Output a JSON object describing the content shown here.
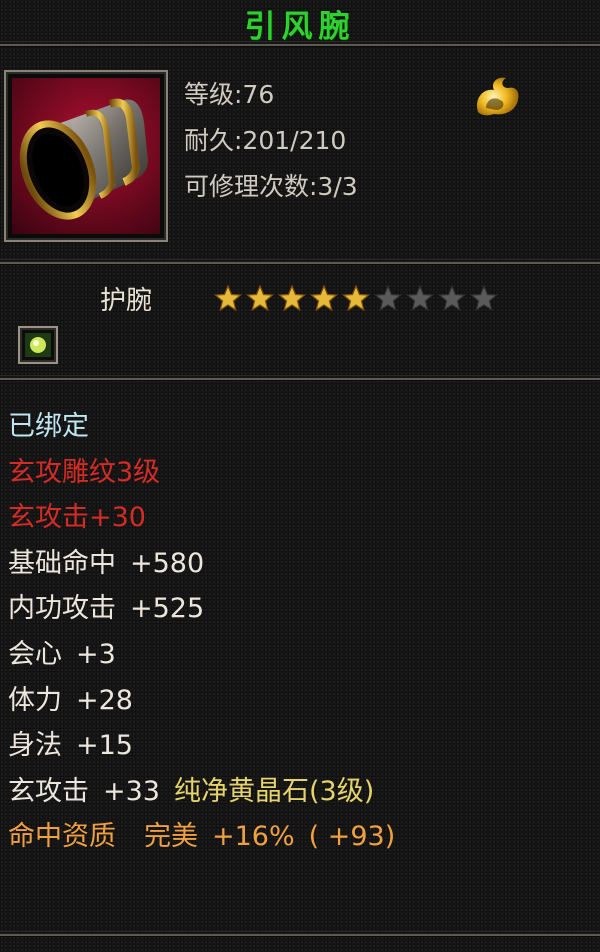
{
  "item": {
    "name": "引风腕",
    "level_label": "等级:76",
    "durability_label": "耐久:201/210",
    "repair_label": "可修理次数:3/3",
    "type": "护腕",
    "stars": {
      "filled": 5,
      "total": 9
    },
    "colors": {
      "title": "#2fd12f",
      "bound": "#bfe6f2",
      "red": "#d42b25",
      "white": "#ece6dc",
      "orange": "#f0a040",
      "gem": "#e6d46a",
      "star_on": "#e8b83a",
      "star_off": "#5a5a5a"
    },
    "icons": [
      "bracer-item-icon",
      "flame-badge-icon",
      "gem-socket-icon",
      "star-icon"
    ]
  },
  "properties": {
    "bound": "已绑定",
    "engrave": "玄攻雕纹3级",
    "xuan_red_name": "玄攻击",
    "xuan_red_value": "+30",
    "hit_name": "基础命中",
    "hit_value": "+580",
    "inner_name": "内功攻击",
    "inner_value": "+525",
    "crit_name": "会心",
    "crit_value": "+3",
    "vit_name": "体力",
    "vit_value": "+28",
    "agi_name": "身法",
    "agi_value": "+15",
    "gem_stat_name": "玄攻击",
    "gem_stat_value": "+33",
    "gem_name": "纯净黄晶石(3级)",
    "quality_name": "命中资质",
    "quality_grade": "完美",
    "quality_pct": "+16%",
    "quality_bonus": "( +93)"
  }
}
